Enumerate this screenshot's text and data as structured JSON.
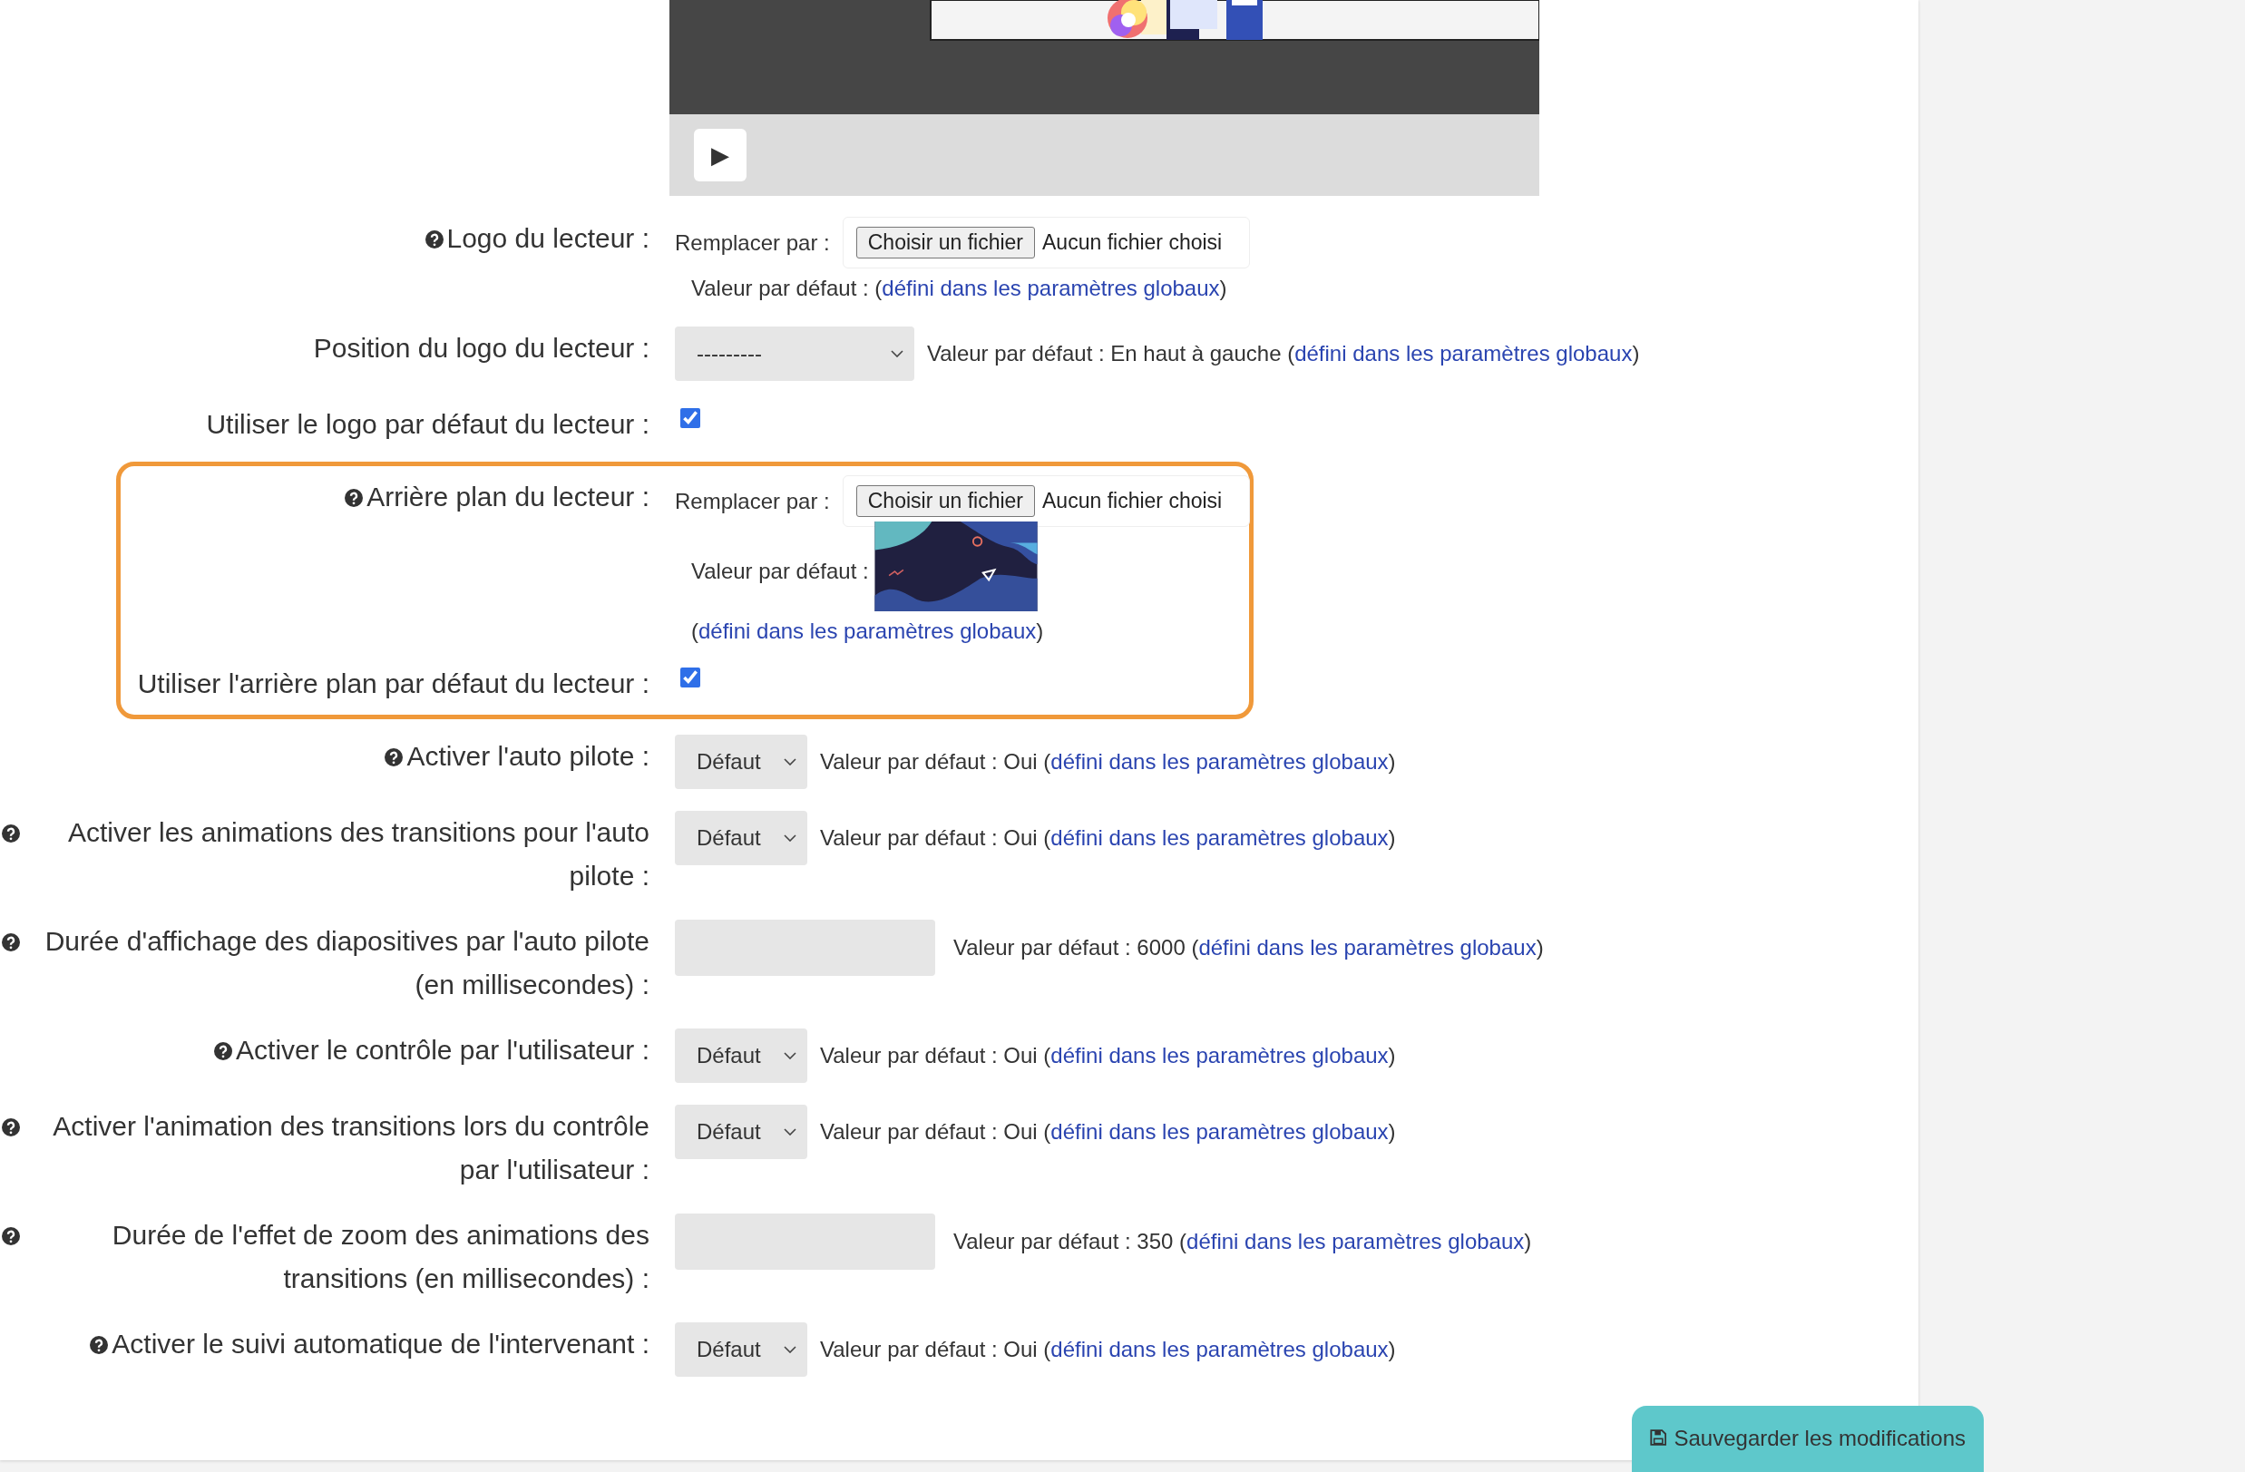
{
  "player": {
    "play_label": "▶"
  },
  "sections": [
    {
      "highlighted": false,
      "rows": [
        {
          "kind": "file",
          "help": true,
          "label": "Logo du lecteur :",
          "replace_label": "Remplacer par :",
          "file_button": "Choisir un fichier",
          "file_status": "Aucun fichier choisi",
          "default_prefix": "Valeur par défaut : (",
          "link": "défini dans les paramètres globaux",
          "default_suffix": ")"
        },
        {
          "kind": "select",
          "help": false,
          "label": "Position du logo du lecteur :",
          "value": "---------",
          "default_prefix": "Valeur par défaut : En haut à gauche (",
          "link": "défini dans les paramètres globaux",
          "default_suffix": ")"
        },
        {
          "kind": "checkbox",
          "help": false,
          "label": "Utiliser le logo par défaut du lecteur :",
          "checked": true
        }
      ]
    },
    {
      "highlighted": true,
      "rows": [
        {
          "kind": "file_image",
          "help": true,
          "label": "Arrière plan du lecteur :",
          "replace_label": "Remplacer par :",
          "file_button": "Choisir un fichier",
          "file_status": "Aucun fichier choisi",
          "default_prefix": "Valeur par défaut :",
          "link_prefix": "(",
          "link": "défini dans les paramètres globaux",
          "default_suffix": ")"
        },
        {
          "kind": "checkbox",
          "help": false,
          "label": "Utiliser l'arrière plan par défaut du lecteur :",
          "checked": true
        }
      ]
    },
    {
      "highlighted": false,
      "rows": [
        {
          "kind": "select",
          "help": true,
          "label": "Activer l'auto pilote :",
          "value": "Défaut",
          "default_prefix": "Valeur par défaut : Oui (",
          "link": "défini dans les paramètres globaux",
          "default_suffix": ")"
        },
        {
          "kind": "select",
          "help": true,
          "label": "Activer les animations des transitions pour l'auto pilote :",
          "value": "Défaut",
          "default_prefix": "Valeur par défaut : Oui (",
          "link": "défini dans les paramètres globaux",
          "default_suffix": ")"
        },
        {
          "kind": "input",
          "help": true,
          "label": "Durée d'affichage des diapositives par l'auto pilote (en millisecondes) :",
          "default_prefix": "Valeur par défaut : 6000 (",
          "link": "défini dans les paramètres globaux",
          "default_suffix": ")"
        },
        {
          "kind": "select",
          "help": true,
          "label": "Activer le contrôle par l'utilisateur :",
          "value": "Défaut",
          "default_prefix": "Valeur par défaut : Oui (",
          "link": "défini dans les paramètres globaux",
          "default_suffix": ")"
        },
        {
          "kind": "select",
          "help": true,
          "label": "Activer l'animation des transitions lors du contrôle par l'utilisateur :",
          "value": "Défaut",
          "default_prefix": "Valeur par défaut : Oui (",
          "link": "défini dans les paramètres globaux",
          "default_suffix": ")"
        },
        {
          "kind": "input",
          "help": true,
          "label": "Durée de l'effet de zoom des animations des transitions (en millisecondes) :",
          "default_prefix": "Valeur par défaut : 350 (",
          "link": "défini dans les paramètres globaux",
          "default_suffix": ")"
        },
        {
          "kind": "select",
          "help": true,
          "label": "Activer le suivi automatique de l'intervenant :",
          "value": "Défaut",
          "default_prefix": "Valeur par défaut : Oui (",
          "link": "défini dans les paramètres globaux",
          "default_suffix": ")"
        }
      ]
    }
  ],
  "save_button": "Sauvegarder les modifications"
}
